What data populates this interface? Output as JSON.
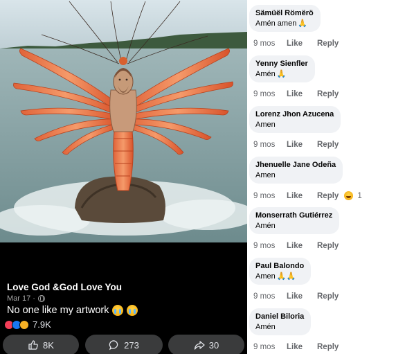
{
  "post": {
    "author": "Love God &God Love You",
    "date": "Mar 17 ·",
    "caption": "No one like my artwork",
    "reaction_count": "7.9K",
    "actions": {
      "like_count": "8K",
      "comment_count": "273",
      "share_count": "30"
    }
  },
  "comments": [
    {
      "name": "Sämüël Römërö",
      "text": "Amén amen",
      "emoji": "🙏",
      "time": "9 mos",
      "like": "Like",
      "reply": "Reply"
    },
    {
      "name": "Yenny Sienfler",
      "text": "Amén",
      "emoji": "🙏",
      "time": "9 mos",
      "like": "Like",
      "reply": "Reply"
    },
    {
      "name": "Lorenz Jhon Azucena",
      "text": "Amen",
      "emoji": "",
      "time": "9 mos",
      "like": "Like",
      "reply": "Reply"
    },
    {
      "name": "Jhenuelle Jane Odeña",
      "text": "Amen",
      "emoji": "",
      "time": "9 mos",
      "like": "Like",
      "reply": "Reply",
      "reaction_count": "1"
    },
    {
      "name": "Monserrath Gutiérrez",
      "text": "Amén",
      "emoji": "",
      "time": "9 mos",
      "like": "Like",
      "reply": "Reply"
    },
    {
      "name": "Paul Balondo",
      "text": "Amen",
      "emoji": "🙏🙏",
      "time": "9 mos",
      "like": "Like",
      "reply": "Reply"
    },
    {
      "name": "Daniel Biloria",
      "text": "Amén",
      "emoji": "",
      "time": "9 mos",
      "like": "Like",
      "reply": "Reply"
    }
  ],
  "colors": {
    "left_background": "#000000",
    "action_button": "#3a3b3c",
    "comment_bubble": "#f0f2f5",
    "meta_text": "#65676b"
  },
  "icons": [
    "globe-icon",
    "cry-emoji",
    "love-reaction-icon",
    "like-reaction-icon",
    "care-reaction-icon",
    "thumbs-up-icon",
    "comment-icon",
    "share-icon",
    "praying-hands-emoji",
    "laugh-reaction-icon"
  ]
}
